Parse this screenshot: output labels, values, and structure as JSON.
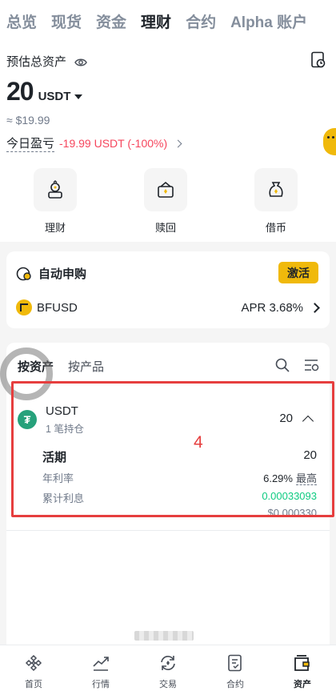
{
  "top_tabs": [
    "总览",
    "现货",
    "资金",
    "理财",
    "合约",
    "Alpha 账户"
  ],
  "active_top_tab": "理财",
  "summary": {
    "label": "预估总资产",
    "amount": "20",
    "unit": "USDT",
    "usd_approx": "≈ $19.99",
    "pnl_label": "今日盈亏",
    "pnl_value": "-19.99 USDT (-100%)"
  },
  "actions": [
    {
      "label": "理财",
      "icon": "earn-icon"
    },
    {
      "label": "赎回",
      "icon": "redeem-icon"
    },
    {
      "label": "借币",
      "icon": "borrow-icon"
    }
  ],
  "auto_subscribe": {
    "title": "自动申购",
    "button": "激活",
    "product": "BFUSD",
    "apr": "APR 3.68%"
  },
  "list": {
    "tabs": [
      "按资产",
      "按产品"
    ],
    "active_tab": "按资产",
    "asset": {
      "name": "USDT",
      "subtitle": "1 笔持仓",
      "amount": "20",
      "detail": {
        "type_label": "活期",
        "type_amount": "20",
        "apr_label": "年利率",
        "apr_value": "6.29%",
        "apr_max": "最高",
        "interest_label": "累计利息",
        "interest_value": "0.00033093",
        "interest_usd": "$0.000330"
      }
    }
  },
  "annotation": {
    "label": "4",
    "color": "#e63e3e"
  },
  "bottom_nav": [
    {
      "label": "首页",
      "icon": "home-icon"
    },
    {
      "label": "行情",
      "icon": "markets-icon"
    },
    {
      "label": "交易",
      "icon": "trade-icon"
    },
    {
      "label": "合约",
      "icon": "futures-icon"
    },
    {
      "label": "资产",
      "icon": "wallet-icon"
    }
  ],
  "colors": {
    "accent": "#f0b90b",
    "negative": "#f6465d",
    "positive": "#0ecb81"
  }
}
